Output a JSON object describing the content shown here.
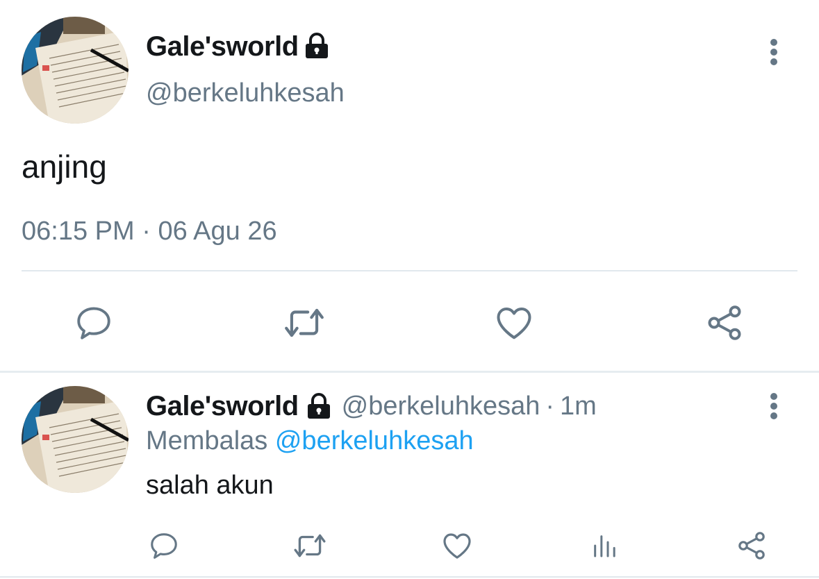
{
  "main_tweet": {
    "display_name": "Gale'sworld",
    "handle": "@berkeluhkesah",
    "text": "anjing",
    "time": "06:15 PM",
    "separator": "·",
    "date": "06 Agu 26",
    "protected_icon": "lock-icon",
    "actions": [
      "reply-icon",
      "retweet-icon",
      "like-icon",
      "share-icon"
    ]
  },
  "reply_tweet": {
    "display_name": "Gale'sworld",
    "handle": "@berkeluhkesah",
    "separator": "·",
    "age": "1m",
    "replying_label": "Membalas",
    "replying_to": "@berkeluhkesah",
    "text": "salah akun",
    "protected_icon": "lock-icon",
    "actions": [
      "reply-icon",
      "retweet-icon",
      "like-icon",
      "analytics-icon",
      "share-icon"
    ]
  },
  "colors": {
    "text": "#14171a",
    "muted": "#657786",
    "link": "#1da1f2",
    "divider": "#e1e8ed"
  }
}
